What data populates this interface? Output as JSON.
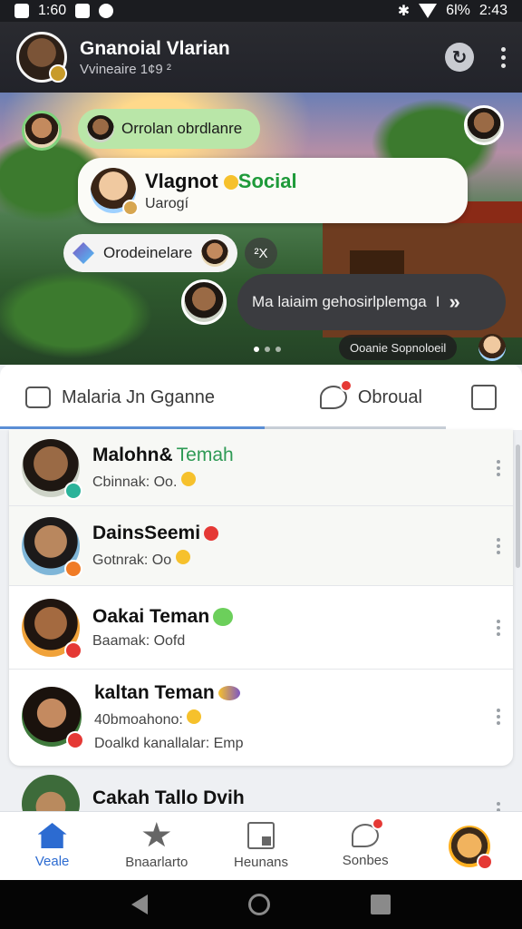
{
  "status_bar": {
    "left_text": "1:60",
    "battery": "6l%",
    "time": "2:43"
  },
  "header": {
    "title": "Gnanoial Vlarian",
    "subtitle": "Vvineaire 1¢9 ²"
  },
  "hero": {
    "pill_green": "Orrolan obrdlanre",
    "card_title_a": "Vlagnot ",
    "card_title_b": "Social",
    "card_subtitle": "Uarogí",
    "pill_white": "Orodeinelare",
    "chip_x": "²X",
    "dark_message": "Ma laiaim gehosirlplemga",
    "dark_message_num": "I",
    "promo": "Ooanie Sopnoloeil"
  },
  "tabs": [
    {
      "label": "Malaria Jn Gganne"
    },
    {
      "label": "Obroual"
    }
  ],
  "contacts": [
    {
      "name": "Malohn&",
      "name_extra": "Temah",
      "status": "Cbinnak: Oo."
    },
    {
      "name": "DainsSeemi",
      "name_extra": "",
      "status": "Gotnrak: Oo"
    },
    {
      "name": "Oakai Teman",
      "name_extra": "",
      "status": "Baamak: Oofd"
    },
    {
      "name": "kaltan Teman",
      "name_extra": "",
      "status": "40bmoahono:",
      "status2": "Doalkd kanallalar: Emp"
    },
    {
      "name": "Cakah Tallo Dvih",
      "name_extra": "",
      "status": ""
    }
  ],
  "bottom_nav": [
    {
      "label": "Veale",
      "icon": "home-icon"
    },
    {
      "label": "Bnaarlarto",
      "icon": "star-icon"
    },
    {
      "label": "Heunans",
      "icon": "grid-icon"
    },
    {
      "label": "Sonbes",
      "icon": "chat-icon"
    }
  ],
  "colors": {
    "accent": "#2c6bd1",
    "notif": "#e53935",
    "green": "#2e9a55"
  }
}
